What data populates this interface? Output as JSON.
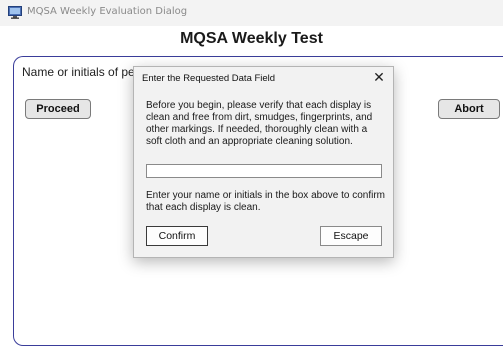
{
  "window": {
    "title": "MQSA Weekly Evaluation Dialog",
    "icon": "monitor-app-icon"
  },
  "main": {
    "heading": "MQSA Weekly Test",
    "name_prompt": "Name or initials of per",
    "proceed_label": "Proceed",
    "abort_label": "Abort"
  },
  "dialog": {
    "title": "Enter the Requested Data Field",
    "close_glyph": "✕",
    "instructions": "Before you begin, please verify that each display is clean and free from dirt, smudges, fingerprints, and other markings. If needed, thoroughly clean with a soft cloth and an appropriate cleaning solution.",
    "input_value": "",
    "help": "Enter your name or initials in the box above to confirm that each display is clean.",
    "confirm_label": "Confirm",
    "escape_label": "Escape"
  },
  "colors": {
    "panel_border": "#3a3d9a",
    "dialog_bg": "#f2f2f2"
  }
}
